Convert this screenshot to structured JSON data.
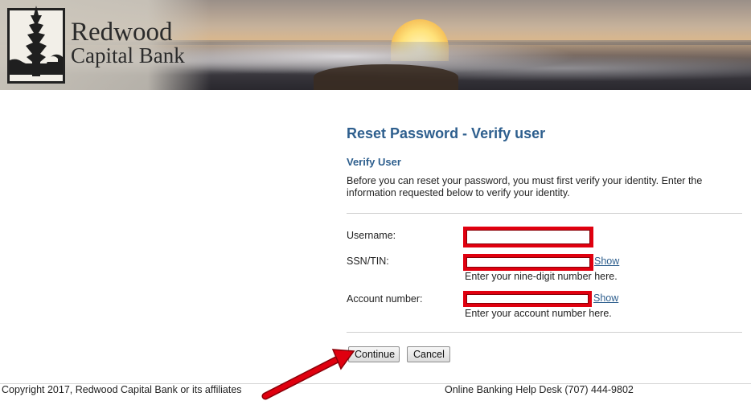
{
  "header": {
    "bank_name_line1": "Redwood",
    "bank_name_line2": "Capital Bank",
    "logo_icon": "redwood-tree-icon"
  },
  "page": {
    "title": "Reset Password - Verify user",
    "section_title": "Verify User",
    "description": "Before you can reset your password, you must first verify your identity. Enter the information requested below to verify your identity."
  },
  "form": {
    "username": {
      "label": "Username:",
      "value": "",
      "placeholder": ""
    },
    "ssn_tin": {
      "label": "SSN/TIN:",
      "value": "",
      "show_label": "Show",
      "hint": "Enter your nine-digit number here."
    },
    "account_number": {
      "label": "Account number:",
      "value": "",
      "show_label": "Show",
      "hint": "Enter your account number here."
    },
    "highlight_color": "#e0000f"
  },
  "buttons": {
    "continue_label": "Continue",
    "cancel_label": "Cancel"
  },
  "footer": {
    "copyright": "Copyright 2017, Redwood Capital Bank or its affiliates",
    "help_desk": "Online Banking Help Desk (707) 444-9802"
  },
  "annotation": {
    "arrow_color": "#e0000f",
    "arrow_icon": "red-arrow-annotation"
  }
}
